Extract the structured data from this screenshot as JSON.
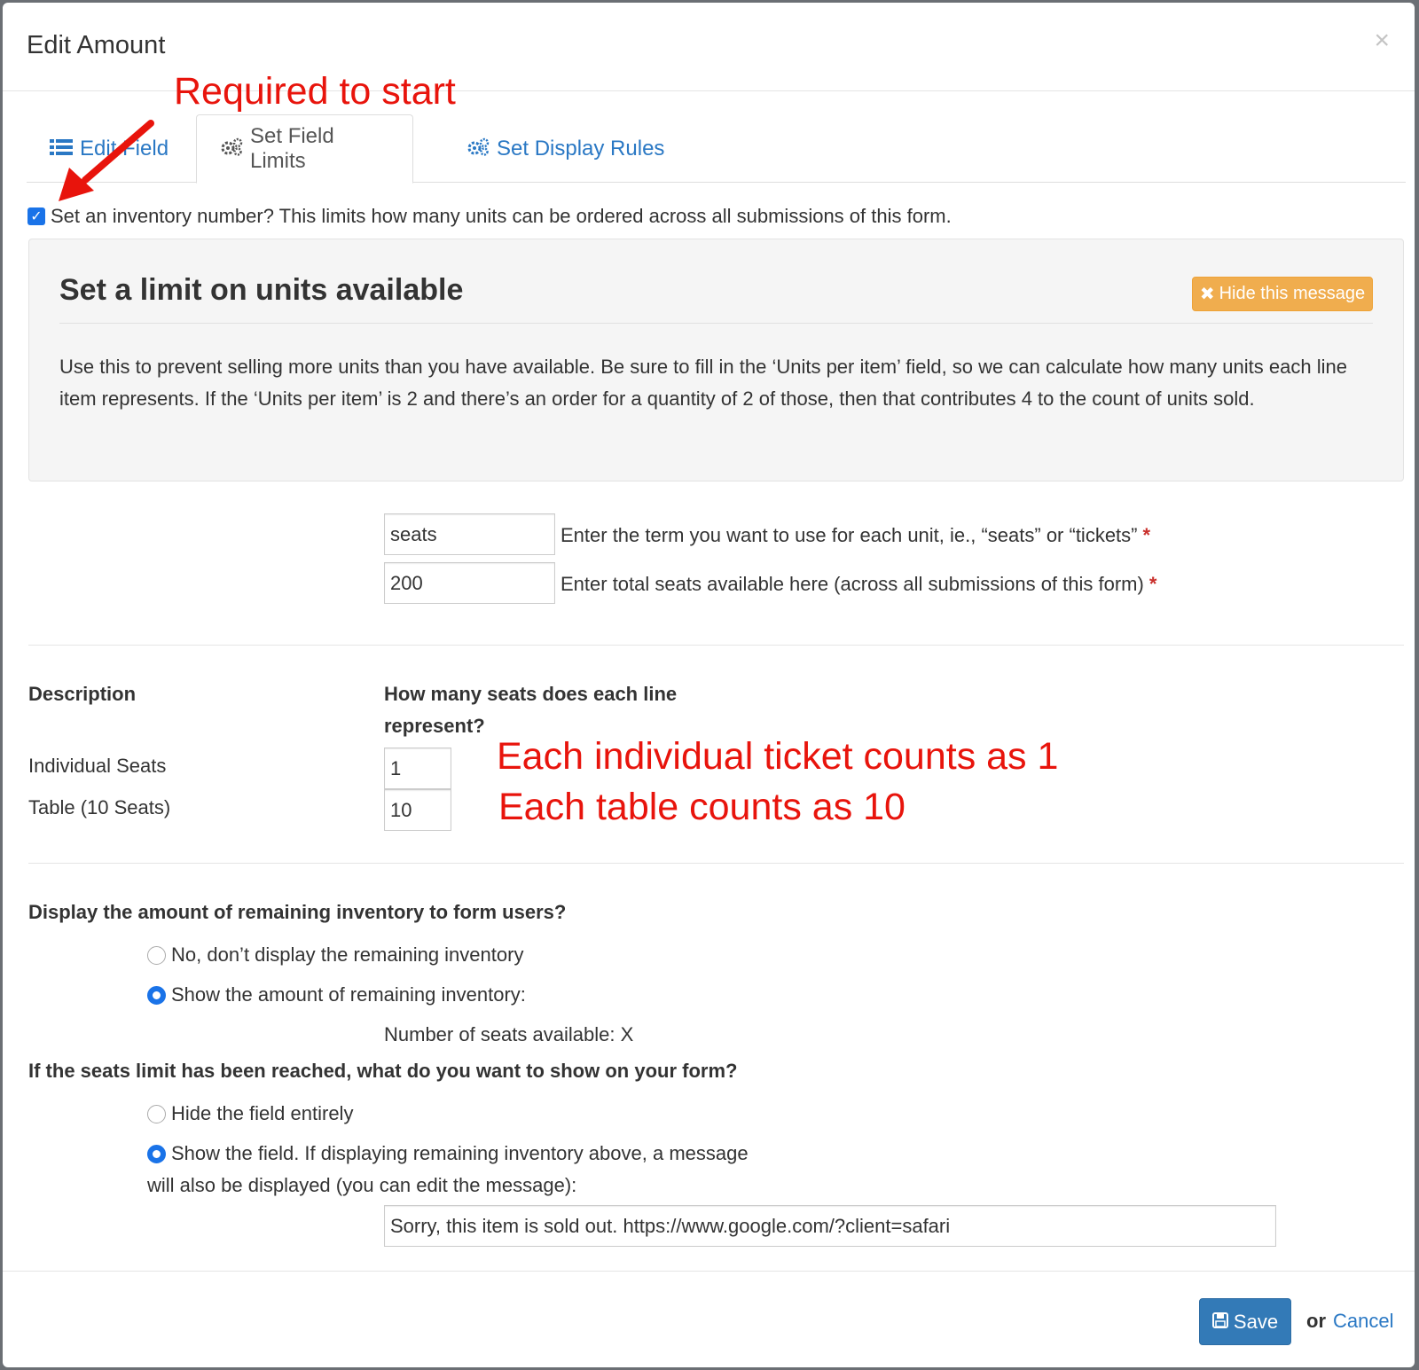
{
  "modal": {
    "title": "Edit Amount",
    "close_label": "×"
  },
  "annotations": {
    "required": "Required to start",
    "individual": "Each individual ticket counts as 1",
    "table": "Each table counts as 10",
    "color": "#e8140c"
  },
  "tabs": [
    {
      "label": "Edit Field",
      "icon": "list-icon"
    },
    {
      "label": "Set Field Limits",
      "icon": "gears-icon",
      "active": true
    },
    {
      "label": "Set Display Rules",
      "icon": "gears-icon"
    }
  ],
  "inventory_checkbox": {
    "checked": true,
    "label": "Set an inventory number? This limits how many units can be ordered across all submissions of this form."
  },
  "info_box": {
    "title": "Set a limit on units available",
    "hide_button": "Hide this message",
    "body": "Use this to prevent selling more units than you have available. Be sure to fill in the ‘Units per item’ field, so we can calculate how many units each line item represents. If the ‘Units per item’ is 2 and there’s an order for a quantity of 2 of those, then that contributes 4 to the count of units sold."
  },
  "unit_term": {
    "value": "seats",
    "label": "Enter the term you want to use for each unit, ie., “seats” or “tickets”",
    "required_mark": "*"
  },
  "total_units": {
    "value": "200",
    "label": "Enter total seats available here (across all submissions of this form)",
    "required_mark": "*"
  },
  "units_table": {
    "headers": [
      "Description",
      "How many seats does each line represent?"
    ],
    "rows": [
      {
        "description": "Individual Seats",
        "units": "1"
      },
      {
        "description": "Table (10 Seats)",
        "units": "10"
      }
    ]
  },
  "display_inventory": {
    "question": "Display the amount of remaining inventory to form users?",
    "options": [
      {
        "label": "No, don’t display the remaining inventory",
        "selected": false
      },
      {
        "label": "Show the amount of remaining inventory:",
        "selected": true
      }
    ],
    "preview_text": "Number of seats available: X"
  },
  "limit_reached": {
    "question": "If the seats limit has been reached, what do you want to show on your form?",
    "options": [
      {
        "label": "Hide the field entirely",
        "selected": false
      },
      {
        "label": "Show the field. If displaying remaining inventory above, a message",
        "selected": true
      }
    ],
    "option_continuation": "will also be displayed (you can edit the message):",
    "message_value": "Sorry, this item is sold out. https://www.google.com/?client=safari"
  },
  "footer": {
    "save_label": "Save",
    "or_text": "or",
    "cancel_label": "Cancel"
  },
  "colors": {
    "primary": "#337ab7",
    "warning": "#f0ad4e",
    "link": "#2a78c4",
    "checkbox": "#1a73e8"
  }
}
